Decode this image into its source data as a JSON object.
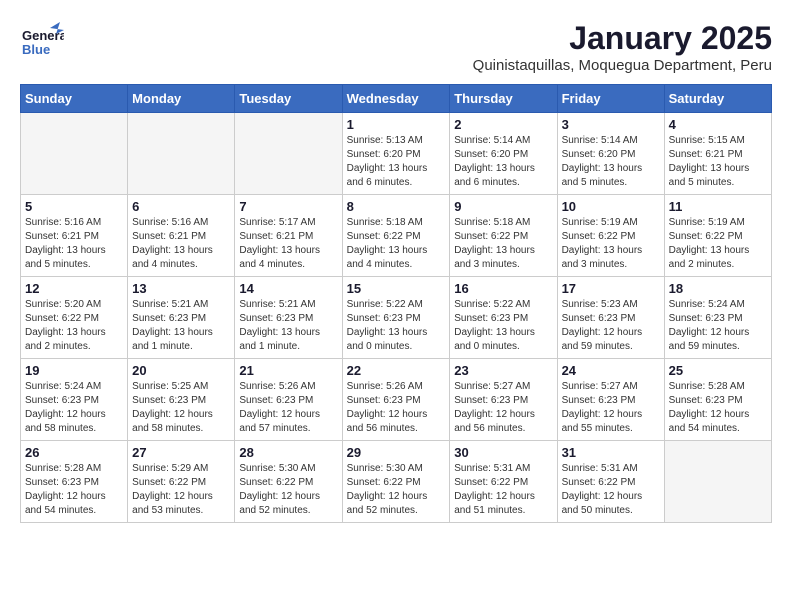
{
  "header": {
    "logo_general": "General",
    "logo_blue": "Blue",
    "month_title": "January 2025",
    "location": "Quinistaquillas, Moquegua Department, Peru"
  },
  "weekdays": [
    "Sunday",
    "Monday",
    "Tuesday",
    "Wednesday",
    "Thursday",
    "Friday",
    "Saturday"
  ],
  "weeks": [
    [
      {
        "day": "",
        "sunrise": "",
        "sunset": "",
        "daylight": ""
      },
      {
        "day": "",
        "sunrise": "",
        "sunset": "",
        "daylight": ""
      },
      {
        "day": "",
        "sunrise": "",
        "sunset": "",
        "daylight": ""
      },
      {
        "day": "1",
        "sunrise": "Sunrise: 5:13 AM",
        "sunset": "Sunset: 6:20 PM",
        "daylight": "Daylight: 13 hours and 6 minutes."
      },
      {
        "day": "2",
        "sunrise": "Sunrise: 5:14 AM",
        "sunset": "Sunset: 6:20 PM",
        "daylight": "Daylight: 13 hours and 6 minutes."
      },
      {
        "day": "3",
        "sunrise": "Sunrise: 5:14 AM",
        "sunset": "Sunset: 6:20 PM",
        "daylight": "Daylight: 13 hours and 5 minutes."
      },
      {
        "day": "4",
        "sunrise": "Sunrise: 5:15 AM",
        "sunset": "Sunset: 6:21 PM",
        "daylight": "Daylight: 13 hours and 5 minutes."
      }
    ],
    [
      {
        "day": "5",
        "sunrise": "Sunrise: 5:16 AM",
        "sunset": "Sunset: 6:21 PM",
        "daylight": "Daylight: 13 hours and 5 minutes."
      },
      {
        "day": "6",
        "sunrise": "Sunrise: 5:16 AM",
        "sunset": "Sunset: 6:21 PM",
        "daylight": "Daylight: 13 hours and 4 minutes."
      },
      {
        "day": "7",
        "sunrise": "Sunrise: 5:17 AM",
        "sunset": "Sunset: 6:21 PM",
        "daylight": "Daylight: 13 hours and 4 minutes."
      },
      {
        "day": "8",
        "sunrise": "Sunrise: 5:18 AM",
        "sunset": "Sunset: 6:22 PM",
        "daylight": "Daylight: 13 hours and 4 minutes."
      },
      {
        "day": "9",
        "sunrise": "Sunrise: 5:18 AM",
        "sunset": "Sunset: 6:22 PM",
        "daylight": "Daylight: 13 hours and 3 minutes."
      },
      {
        "day": "10",
        "sunrise": "Sunrise: 5:19 AM",
        "sunset": "Sunset: 6:22 PM",
        "daylight": "Daylight: 13 hours and 3 minutes."
      },
      {
        "day": "11",
        "sunrise": "Sunrise: 5:19 AM",
        "sunset": "Sunset: 6:22 PM",
        "daylight": "Daylight: 13 hours and 2 minutes."
      }
    ],
    [
      {
        "day": "12",
        "sunrise": "Sunrise: 5:20 AM",
        "sunset": "Sunset: 6:22 PM",
        "daylight": "Daylight: 13 hours and 2 minutes."
      },
      {
        "day": "13",
        "sunrise": "Sunrise: 5:21 AM",
        "sunset": "Sunset: 6:23 PM",
        "daylight": "Daylight: 13 hours and 1 minute."
      },
      {
        "day": "14",
        "sunrise": "Sunrise: 5:21 AM",
        "sunset": "Sunset: 6:23 PM",
        "daylight": "Daylight: 13 hours and 1 minute."
      },
      {
        "day": "15",
        "sunrise": "Sunrise: 5:22 AM",
        "sunset": "Sunset: 6:23 PM",
        "daylight": "Daylight: 13 hours and 0 minutes."
      },
      {
        "day": "16",
        "sunrise": "Sunrise: 5:22 AM",
        "sunset": "Sunset: 6:23 PM",
        "daylight": "Daylight: 13 hours and 0 minutes."
      },
      {
        "day": "17",
        "sunrise": "Sunrise: 5:23 AM",
        "sunset": "Sunset: 6:23 PM",
        "daylight": "Daylight: 12 hours and 59 minutes."
      },
      {
        "day": "18",
        "sunrise": "Sunrise: 5:24 AM",
        "sunset": "Sunset: 6:23 PM",
        "daylight": "Daylight: 12 hours and 59 minutes."
      }
    ],
    [
      {
        "day": "19",
        "sunrise": "Sunrise: 5:24 AM",
        "sunset": "Sunset: 6:23 PM",
        "daylight": "Daylight: 12 hours and 58 minutes."
      },
      {
        "day": "20",
        "sunrise": "Sunrise: 5:25 AM",
        "sunset": "Sunset: 6:23 PM",
        "daylight": "Daylight: 12 hours and 58 minutes."
      },
      {
        "day": "21",
        "sunrise": "Sunrise: 5:26 AM",
        "sunset": "Sunset: 6:23 PM",
        "daylight": "Daylight: 12 hours and 57 minutes."
      },
      {
        "day": "22",
        "sunrise": "Sunrise: 5:26 AM",
        "sunset": "Sunset: 6:23 PM",
        "daylight": "Daylight: 12 hours and 56 minutes."
      },
      {
        "day": "23",
        "sunrise": "Sunrise: 5:27 AM",
        "sunset": "Sunset: 6:23 PM",
        "daylight": "Daylight: 12 hours and 56 minutes."
      },
      {
        "day": "24",
        "sunrise": "Sunrise: 5:27 AM",
        "sunset": "Sunset: 6:23 PM",
        "daylight": "Daylight: 12 hours and 55 minutes."
      },
      {
        "day": "25",
        "sunrise": "Sunrise: 5:28 AM",
        "sunset": "Sunset: 6:23 PM",
        "daylight": "Daylight: 12 hours and 54 minutes."
      }
    ],
    [
      {
        "day": "26",
        "sunrise": "Sunrise: 5:28 AM",
        "sunset": "Sunset: 6:23 PM",
        "daylight": "Daylight: 12 hours and 54 minutes."
      },
      {
        "day": "27",
        "sunrise": "Sunrise: 5:29 AM",
        "sunset": "Sunset: 6:22 PM",
        "daylight": "Daylight: 12 hours and 53 minutes."
      },
      {
        "day": "28",
        "sunrise": "Sunrise: 5:30 AM",
        "sunset": "Sunset: 6:22 PM",
        "daylight": "Daylight: 12 hours and 52 minutes."
      },
      {
        "day": "29",
        "sunrise": "Sunrise: 5:30 AM",
        "sunset": "Sunset: 6:22 PM",
        "daylight": "Daylight: 12 hours and 52 minutes."
      },
      {
        "day": "30",
        "sunrise": "Sunrise: 5:31 AM",
        "sunset": "Sunset: 6:22 PM",
        "daylight": "Daylight: 12 hours and 51 minutes."
      },
      {
        "day": "31",
        "sunrise": "Sunrise: 5:31 AM",
        "sunset": "Sunset: 6:22 PM",
        "daylight": "Daylight: 12 hours and 50 minutes."
      },
      {
        "day": "",
        "sunrise": "",
        "sunset": "",
        "daylight": ""
      }
    ]
  ]
}
